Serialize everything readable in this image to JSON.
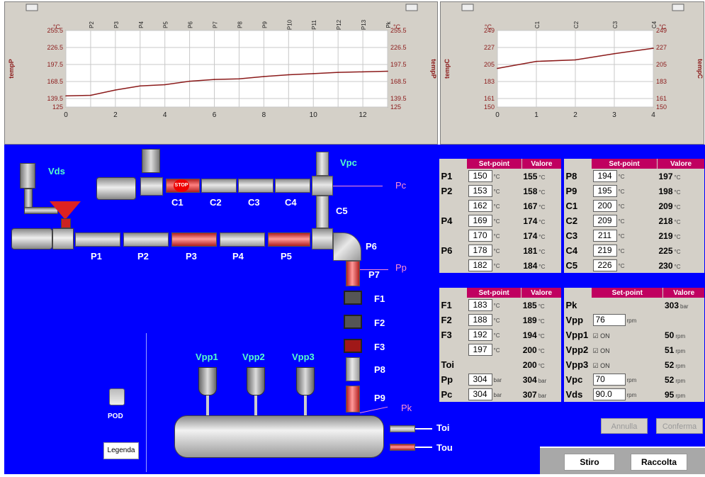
{
  "chart1": {
    "unit_left": "°C",
    "unit_right": "°C",
    "axis_label_left": "tempP",
    "axis_label_right": "tempP",
    "y_ticks": [
      "255.5",
      "226.5",
      "197.5",
      "168.5",
      "139.5",
      "125"
    ],
    "x_ticks": [
      "0",
      "2",
      "4",
      "6",
      "8",
      "10",
      "12"
    ],
    "top_labels": [
      "P2",
      "P3",
      "P4",
      "P5",
      "P6",
      "P7",
      "P8",
      "P9",
      "P10",
      "P11",
      "P12",
      "P13",
      "Pk"
    ]
  },
  "chart2": {
    "unit_left": "°C",
    "unit_right": "°C",
    "axis_label_left": "tempC",
    "axis_label_right": "tempC",
    "y_ticks": [
      "249",
      "227",
      "205",
      "183",
      "161",
      "150"
    ],
    "x_ticks": [
      "0",
      "1",
      "2",
      "3",
      "4"
    ],
    "top_labels": [
      "C1",
      "C2",
      "C3",
      "C4"
    ]
  },
  "chart_data": [
    {
      "type": "line",
      "x": [
        0,
        1,
        2,
        3,
        4,
        5,
        6,
        7,
        8,
        9,
        10,
        11,
        12,
        13
      ],
      "series": [
        {
          "values": [
            144,
            145,
            154,
            161,
            163,
            169,
            172,
            173,
            177,
            180,
            182,
            184,
            185,
            186
          ]
        }
      ],
      "ylim": [
        125,
        255.5
      ],
      "xlim": [
        0,
        13
      ],
      "grid": true,
      "ylabel": "tempP"
    },
    {
      "type": "line",
      "x": [
        0,
        1,
        2,
        3,
        4
      ],
      "series": [
        {
          "values": [
            200,
            209,
            211,
            219,
            226
          ]
        }
      ],
      "ylim": [
        150,
        249
      ],
      "xlim": [
        0,
        4
      ],
      "grid": true,
      "ylabel": "tempC"
    }
  ],
  "diagram": {
    "vds": "Vds",
    "vpc": "Vpc",
    "pc": "Pc",
    "pp": "Pp",
    "pk": "Pk",
    "stop": "STOP",
    "c_labels": [
      "C1",
      "C2",
      "C3",
      "C4",
      "C5"
    ],
    "p_labels": [
      "P1",
      "P2",
      "P3",
      "P4",
      "P5",
      "P6",
      "P7",
      "P8",
      "P9"
    ],
    "f_labels": [
      "F1",
      "F2",
      "F3"
    ],
    "vpp_labels": [
      "Vpp1",
      "Vpp2",
      "Vpp3"
    ],
    "toi": "Toi",
    "tou": "Tou",
    "pod": "POD",
    "legend_button": "Legenda"
  },
  "table_a": {
    "h_setpoint": "Set-point",
    "h_valore": "Valore",
    "rows": [
      {
        "label": "P1",
        "sp": "150",
        "su": "°C",
        "val": "155",
        "vu": "°C"
      },
      {
        "label": "P2",
        "sp": "153",
        "su": "°C",
        "val": "158",
        "vu": "°C"
      },
      {
        "label": "",
        "sp": "162",
        "su": "°C",
        "val": "167",
        "vu": "°C"
      },
      {
        "label": "P4",
        "sp": "169",
        "su": "°C",
        "val": "174",
        "vu": "°C"
      },
      {
        "label": "",
        "sp": "170",
        "su": "°C",
        "val": "174",
        "vu": "°C"
      },
      {
        "label": "P6",
        "sp": "178",
        "su": "°C",
        "val": "181",
        "vu": "°C"
      },
      {
        "label": "",
        "sp": "182",
        "su": "°C",
        "val": "184",
        "vu": "°C"
      }
    ]
  },
  "table_b": {
    "h_setpoint": "Set-point",
    "h_valore": "Valore",
    "rows": [
      {
        "label": "P8",
        "sp": "194",
        "su": "°C",
        "val": "197",
        "vu": "°C"
      },
      {
        "label": "P9",
        "sp": "195",
        "su": "°C",
        "val": "198",
        "vu": "°C"
      },
      {
        "label": "C1",
        "sp": "200",
        "su": "°C",
        "val": "209",
        "vu": "°C"
      },
      {
        "label": "C2",
        "sp": "209",
        "su": "°C",
        "val": "218",
        "vu": "°C"
      },
      {
        "label": "C3",
        "sp": "211",
        "su": "°C",
        "val": "219",
        "vu": "°C"
      },
      {
        "label": "C4",
        "sp": "219",
        "su": "°C",
        "val": "225",
        "vu": "°C"
      },
      {
        "label": "C5",
        "sp": "226",
        "su": "°C",
        "val": "230",
        "vu": "°C"
      }
    ]
  },
  "table_c": {
    "h_setpoint": "Set-point",
    "h_valore": "Valore",
    "rows": [
      {
        "label": "F1",
        "sp": "183",
        "su": "°C",
        "val": "185",
        "vu": "°C"
      },
      {
        "label": "F2",
        "sp": "188",
        "su": "°C",
        "val": "189",
        "vu": "°C"
      },
      {
        "label": "F3",
        "sp": "192",
        "su": "°C",
        "val": "194",
        "vu": "°C"
      },
      {
        "label": "",
        "sp": "197",
        "su": "°C",
        "val": "200",
        "vu": "°C"
      },
      {
        "label": "Toi",
        "sp": "",
        "su": "",
        "val": "200",
        "vu": "°C"
      },
      {
        "label": "Pp",
        "sp": "304",
        "su": "bar",
        "val": "304",
        "vu": "bar"
      },
      {
        "label": "Pc",
        "sp": "304",
        "su": "bar",
        "val": "307",
        "vu": "bar"
      }
    ]
  },
  "table_d": {
    "h_setpoint": "Set-point",
    "h_valore": "Valore",
    "rows": [
      {
        "label": "Pk",
        "kind": "none",
        "sp": "",
        "su": "",
        "val": "303",
        "vu": "bar"
      },
      {
        "label": "Vpp",
        "kind": "input",
        "sp": "76",
        "su": "rpm",
        "val": "",
        "vu": ""
      },
      {
        "label": "Vpp1",
        "kind": "check",
        "sp": "ON",
        "su": "",
        "val": "50",
        "vu": "rpm"
      },
      {
        "label": "Vpp2",
        "kind": "check",
        "sp": "ON",
        "su": "",
        "val": "51",
        "vu": "rpm"
      },
      {
        "label": "Vpp3",
        "kind": "check",
        "sp": "ON",
        "su": "",
        "val": "52",
        "vu": "rpm"
      },
      {
        "label": "Vpc",
        "kind": "input",
        "sp": "70",
        "su": "rpm",
        "val": "52",
        "vu": "rpm"
      },
      {
        "label": "Vds",
        "kind": "input",
        "sp": "90.0",
        "su": "rpm",
        "val": "95",
        "vu": "rpm"
      }
    ]
  },
  "buttons": {
    "annulla": "Annulla",
    "conferma": "Conferma",
    "stiro": "Stiro",
    "raccolta": "Raccolta"
  },
  "colors": {
    "background": "#0000ff",
    "header": "#c00060",
    "trend": "#8b1a1a",
    "panel": "#d4d0c8"
  }
}
